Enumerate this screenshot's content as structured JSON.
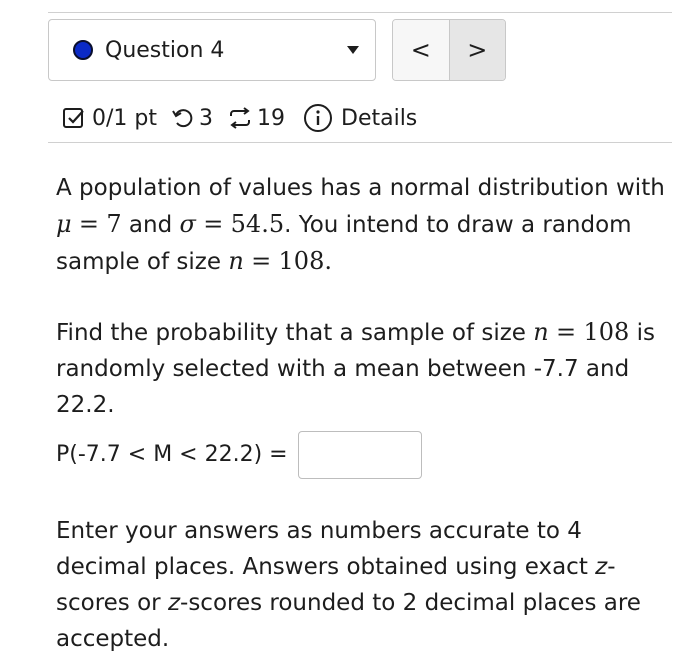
{
  "question_select": {
    "label": "Question 4",
    "dot_color": "#0b2ac7"
  },
  "nav": {
    "prev": "<",
    "next": ">"
  },
  "meta": {
    "score": "0/1 pt",
    "retries": "3",
    "submissions": "19",
    "details": "Details"
  },
  "problem": {
    "intro_a": "A population of values has a normal distribution with ",
    "mu_sym": "μ",
    "eq": "=",
    "mu_val": "7",
    "and": " and ",
    "sigma_sym": "σ",
    "sigma_val": "54.5",
    "intro_b": ". You intend to draw a random sample of size ",
    "n_sym": "n",
    "n_val": "108",
    "period": ".",
    "find_a": "Find the probability that a sample of size ",
    "find_b": " is randomly selected with a mean between -7.7 and 22.2.",
    "answer_label": "P(-7.7 < M < 22.2) =",
    "answer_value": "",
    "instructions_a": "Enter your answers as numbers accurate to 4 decimal places. Answers obtained using exact ",
    "z1": "z",
    "instructions_b": "-scores or ",
    "z2": "z",
    "instructions_c": "-scores rounded to 2 decimal places are accepted."
  }
}
